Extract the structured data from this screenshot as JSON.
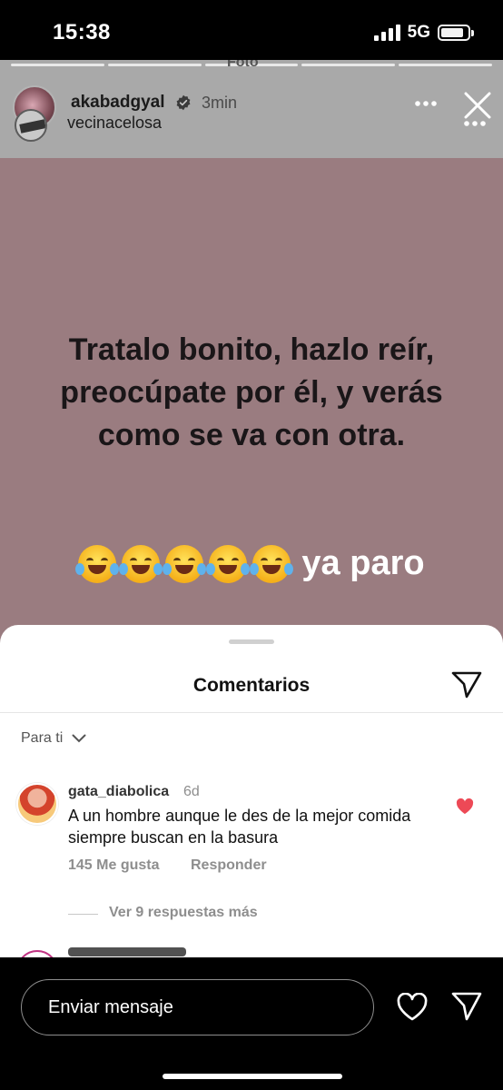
{
  "status_bar": {
    "time": "15:38",
    "network": "5G",
    "battery_level": 0.85
  },
  "story": {
    "header_ghost_text": "Foto",
    "username": "akabadgyal",
    "time_ago": "3min",
    "second_user": "vecinacelosa",
    "quote": "Tratalo bonito, hazlo reír, preocúpate por él, y verás como se va con otra.",
    "emoji_count": 5,
    "emoji_icon": "face-with-tears-of-joy-icon",
    "tail_text": "ya paro",
    "background_color": "#9a7c80"
  },
  "comments_sheet": {
    "title": "Comentarios",
    "sort_label": "Para ti",
    "comments": [
      {
        "username": "gata_diabolica",
        "time": "6d",
        "text": "A un hombre aunque le des de la mejor comida siempre buscan en la basura",
        "likes": "145 Me gusta",
        "reply_label": "Responder",
        "more_replies": "Ver 9 respuestas más",
        "liked": true
      }
    ]
  },
  "bottom_bar": {
    "message_placeholder": "Enviar mensaje"
  },
  "colors": {
    "like_red": "#ed4956",
    "muted_text": "#8e8e8e"
  }
}
